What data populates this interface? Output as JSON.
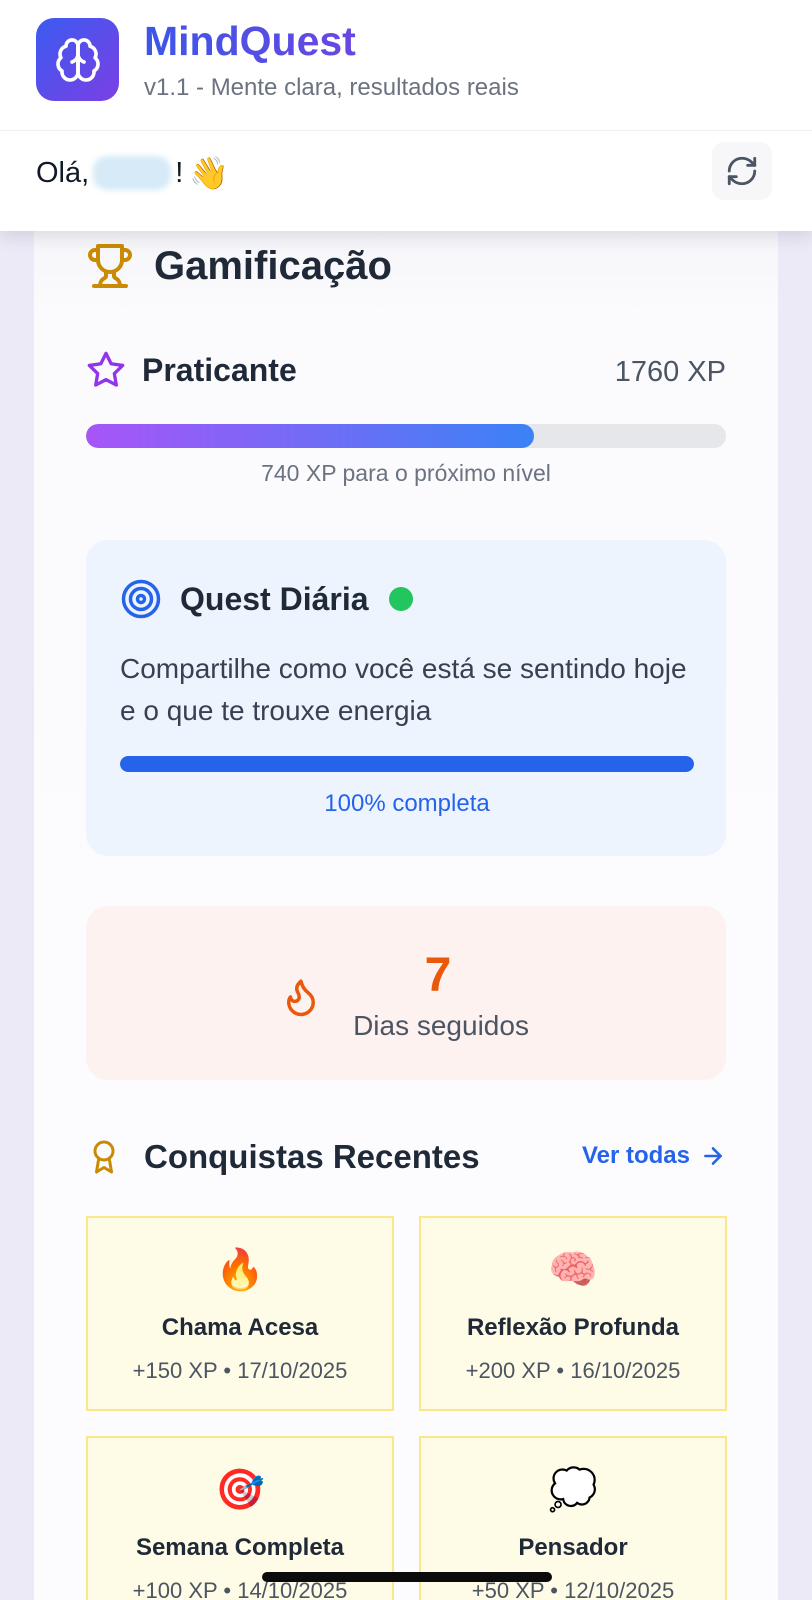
{
  "app": {
    "title": "MindQuest",
    "subtitle": "v1.1 - Mente clara, resultados reais",
    "brand_color": "#4f46e5"
  },
  "header": {
    "greeting": "Olá,",
    "greeting_end": "!",
    "wave_emoji": "👋",
    "refresh_icon": "refresh-icon"
  },
  "gamification": {
    "title": "Gamificação",
    "icon": "trophy-icon",
    "level_name": "Praticante",
    "level_icon": "star-icon",
    "xp_total": "1760 XP",
    "xp_progress_fraction": 0.7,
    "xp_next": "740 XP para o próximo nível"
  },
  "quest": {
    "title": "Quest Diária",
    "icon": "target-icon",
    "status_color": "#22c55e",
    "description": "Compartilhe como você está se sentindo hoje e o que te trouxe energia",
    "progress_fraction": 1.0,
    "progress_label": "100% completa"
  },
  "streak": {
    "count": "7",
    "label": "Dias seguidos",
    "icon": "flame-icon",
    "color": "#ea580c"
  },
  "achievements": {
    "title": "Conquistas Recentes",
    "icon": "ribbon-icon",
    "link_label": "Ver todas",
    "items": [
      {
        "emoji": "🔥",
        "name": "Chama Acesa",
        "meta": "+150 XP • 17/10/2025"
      },
      {
        "emoji": "🧠",
        "name": "Reflexão Profunda",
        "meta": "+200 XP • 16/10/2025"
      },
      {
        "emoji": "🎯",
        "name": "Semana Completa",
        "meta": "+100 XP • 14/10/2025"
      },
      {
        "emoji": "💭",
        "name": "Pensador",
        "meta": "+50 XP • 12/10/2025"
      }
    ]
  }
}
